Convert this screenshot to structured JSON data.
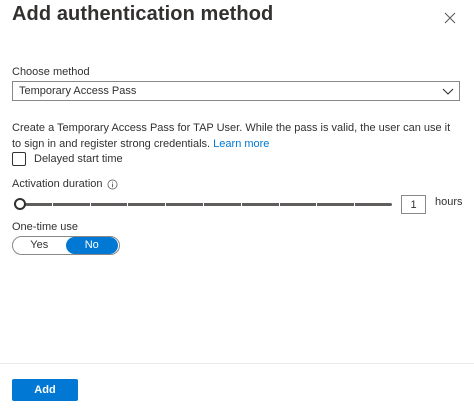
{
  "panel": {
    "title": "Add authentication method",
    "close_icon": "close-icon"
  },
  "method": {
    "label": "Choose method",
    "selected": "Temporary Access Pass",
    "chevron_icon": "chevron-down-icon"
  },
  "description": {
    "text": "Create a Temporary Access Pass for TAP User. While the pass is valid, the user can use it to sign in and register strong credentials. ",
    "link": "Learn more"
  },
  "delayed_start": {
    "label": "Delayed start time",
    "checked": false
  },
  "activation": {
    "label": "Activation duration",
    "info_icon": "info-icon",
    "value": "1",
    "unit": "hours",
    "slider_fraction": 0,
    "tick_count": 10
  },
  "one_time": {
    "label": "One-time use",
    "yes_label": "Yes",
    "no_label": "No",
    "selected": "No"
  },
  "footer": {
    "add_label": "Add"
  },
  "colors": {
    "accent": "#0078d4",
    "text": "#323130",
    "border": "#8a8886"
  }
}
